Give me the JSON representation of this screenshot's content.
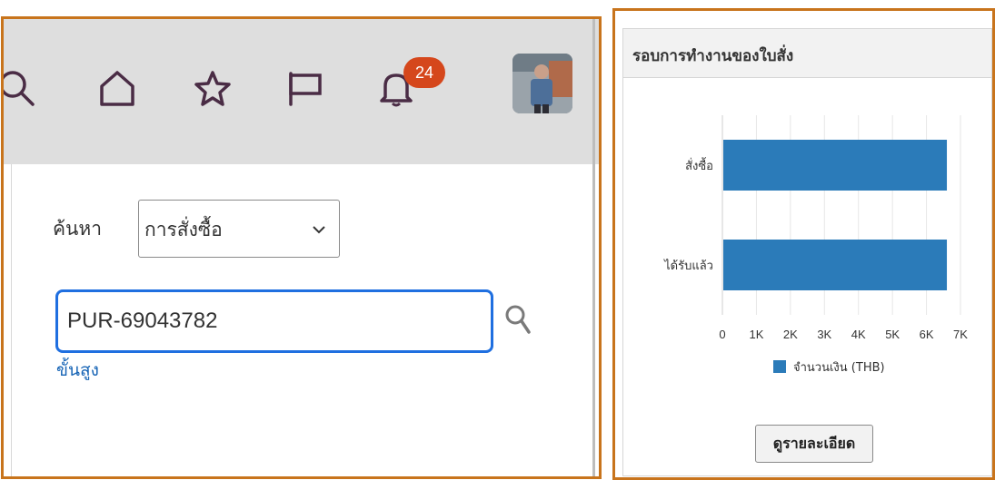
{
  "header": {
    "notification_count": "24",
    "icons": [
      "search-icon",
      "home-icon",
      "star-icon",
      "flag-icon",
      "bell-icon"
    ]
  },
  "search": {
    "label": "ค้นหา",
    "category_selected": "การสั่งซื้อ",
    "query_value": "PUR-69043782",
    "advanced_link": "ขั้นสูง"
  },
  "card": {
    "title": "รอบการทำงานของใบสั่ง",
    "details_button": "ดูรายละเอียด"
  },
  "colors": {
    "accent_border": "#c8741c",
    "bar": "#2b7bb9",
    "badge": "#d5471c",
    "focus": "#1f6fe0",
    "link": "#1563b5"
  },
  "chart_data": {
    "type": "bar",
    "orientation": "horizontal",
    "categories": [
      "สั่งซื้อ",
      "ได้รับแล้ว"
    ],
    "series": [
      {
        "name": "จำนวนเงิน (THB)",
        "values": [
          6600,
          6600
        ]
      }
    ],
    "xlim": [
      0,
      7000
    ],
    "x_ticks": [
      "0",
      "1K",
      "2K",
      "3K",
      "4K",
      "5K",
      "6K",
      "7K"
    ],
    "grid": true,
    "legend_position": "bottom"
  }
}
